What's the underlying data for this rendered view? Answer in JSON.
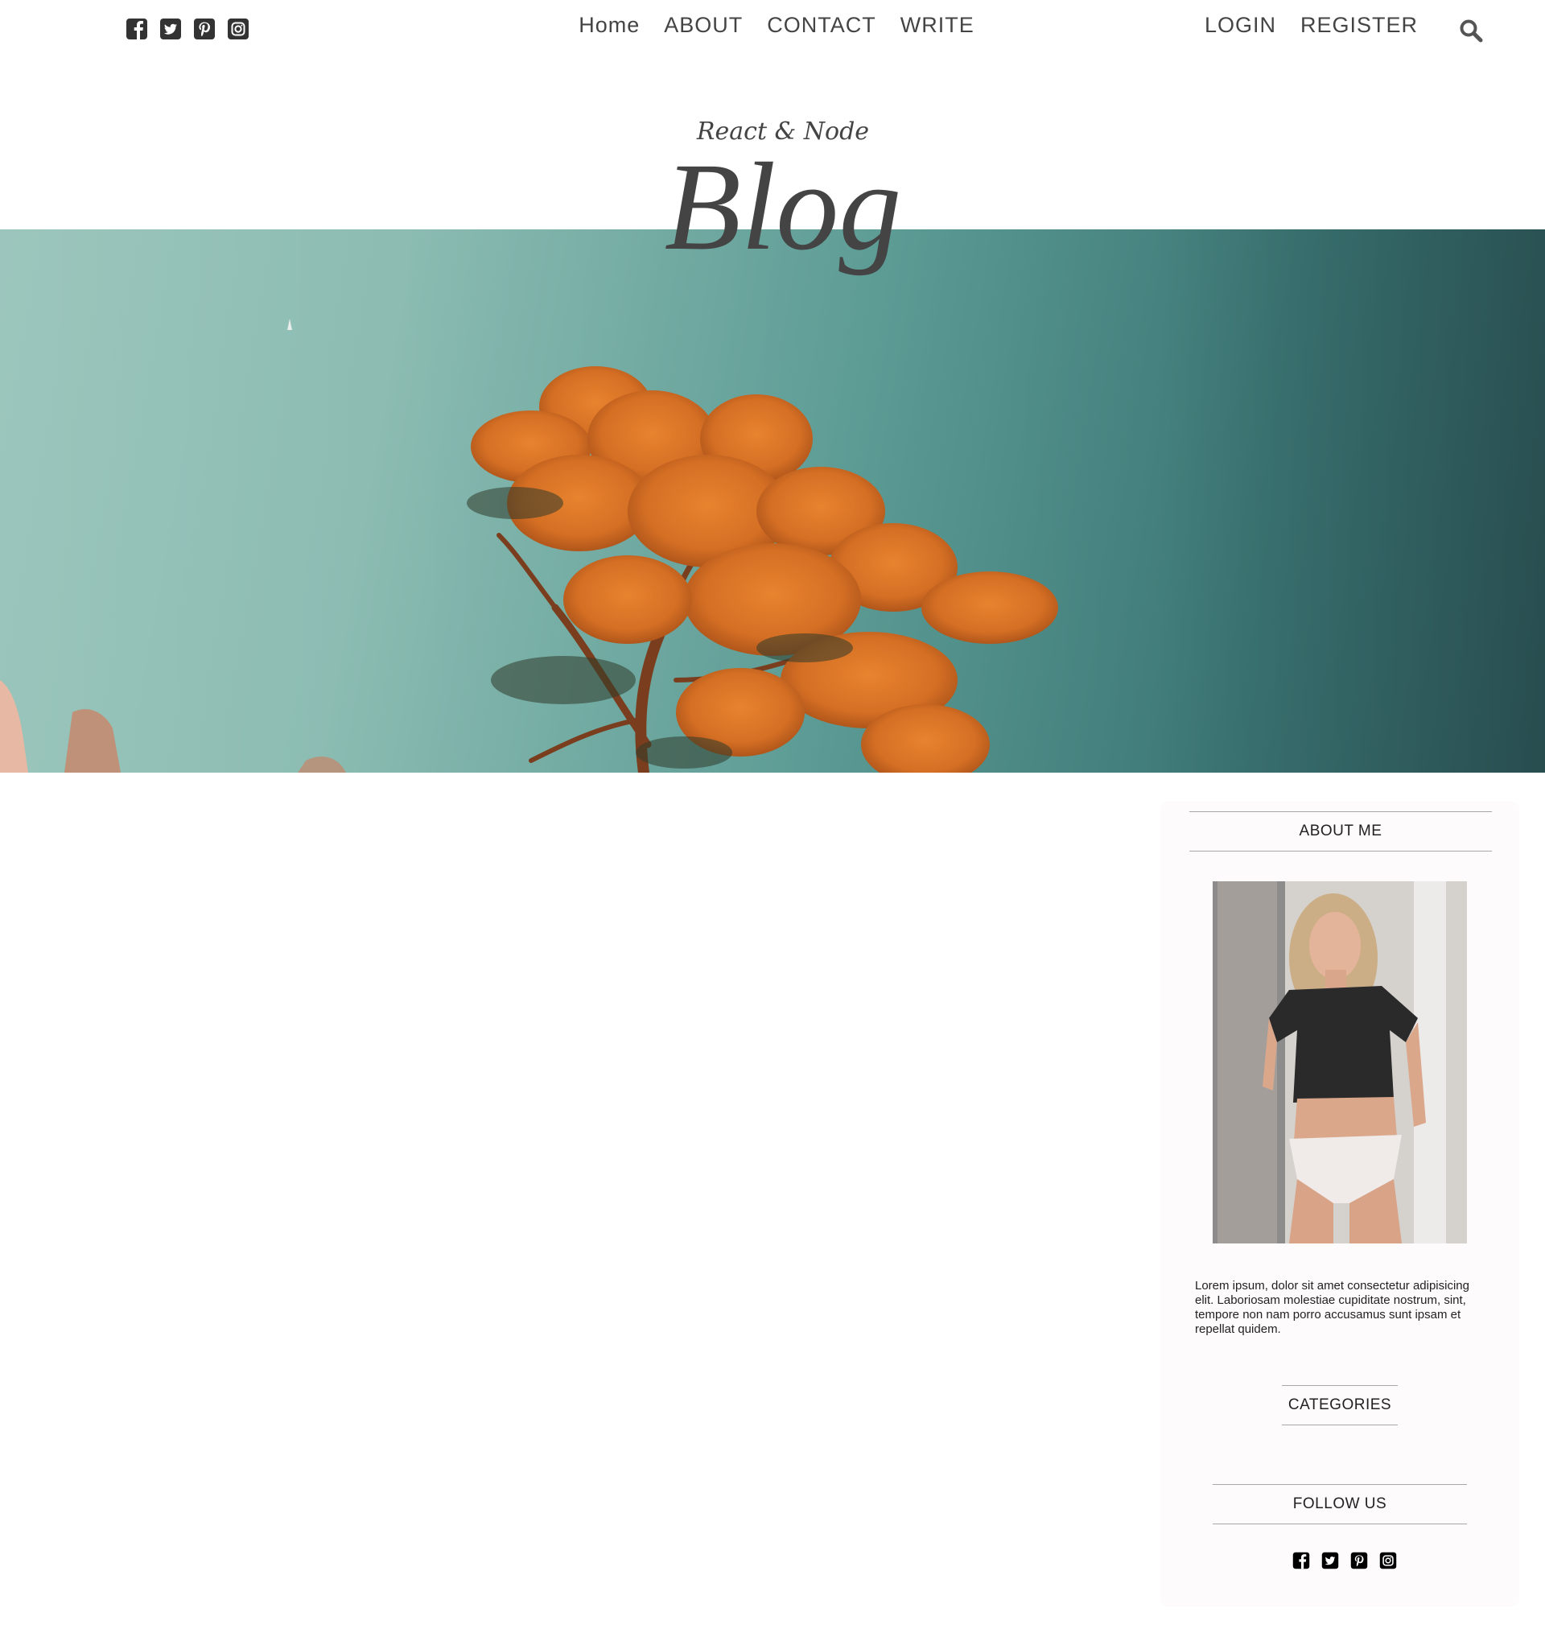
{
  "topbar": {
    "social_icons": [
      "facebook-square-icon",
      "twitter-square-icon",
      "pinterest-square-icon",
      "instagram-square-icon"
    ],
    "nav": [
      {
        "label": "Home"
      },
      {
        "label": "ABOUT"
      },
      {
        "label": "CONTACT"
      },
      {
        "label": "WRITE"
      }
    ],
    "auth": [
      {
        "label": "LOGIN"
      },
      {
        "label": "REGISTER"
      }
    ],
    "search_icon": "search-icon"
  },
  "header": {
    "subtitle": "React & Node",
    "title": "Blog"
  },
  "hero": {
    "image_alt": "orange-leaved tree against teal water"
  },
  "sidebar": {
    "about_title": "ABOUT ME",
    "about_image_alt": "profile photo",
    "about_text": "Lorem ipsum, dolor sit amet consectetur adipisicing elit. Laboriosam molestiae cupiditate nostrum, sint, tempore non nam porro accusamus sunt ipsam et repellat quidem.",
    "categories_title": "CATEGORIES",
    "follow_title": "FOLLOW US",
    "social_icons": [
      "facebook-square-icon",
      "twitter-square-icon",
      "pinterest-square-icon",
      "instagram-square-icon"
    ]
  },
  "colors": {
    "text": "#444444",
    "sidebar_bg": "#fdfbfb",
    "hero_teal": "#5fa19a",
    "tree_orange": "#d9782a"
  }
}
